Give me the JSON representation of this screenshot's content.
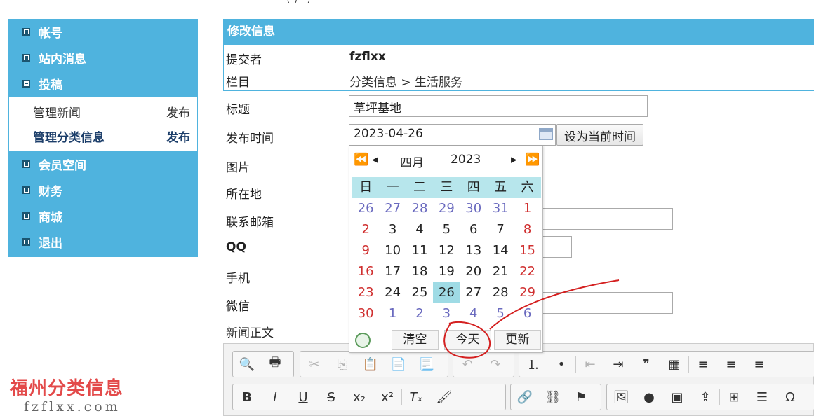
{
  "sidebar": {
    "groups": [
      {
        "label": "帐号"
      },
      {
        "label": "站内消息"
      },
      {
        "label": "投稿"
      }
    ],
    "sub_items": [
      {
        "label": "管理新闻",
        "action": "发布"
      },
      {
        "label": "管理分类信息",
        "action": "发布"
      }
    ],
    "groups2": [
      {
        "label": "会员空间"
      },
      {
        "label": "财务"
      },
      {
        "label": "商城"
      },
      {
        "label": "退出"
      }
    ]
  },
  "brand": {
    "title": "福州分类信息",
    "domain": "fzflxx.com"
  },
  "form": {
    "header": "修改信息",
    "submitter_label": "提交者",
    "submitter_value": "fzflxx",
    "category_label": "栏目",
    "category_value": "分类信息 > 生活服务",
    "title_label": "标题",
    "title_value": "草坪基地",
    "pubtime_label": "发布时间",
    "pubtime_value": "2023-04-26",
    "set_now_label": "设为当前时间",
    "image_label": "图片",
    "location_label": "所在地",
    "email_label": "联系邮箱",
    "qq_label": "QQ",
    "phone_label": "手机",
    "wechat_label": "微信",
    "body_label": "新闻正文"
  },
  "calendar": {
    "month": "四月",
    "year": "2023",
    "weekdays": [
      "日",
      "一",
      "二",
      "三",
      "四",
      "五",
      "六"
    ],
    "weeks": [
      [
        "26",
        "27",
        "28",
        "29",
        "30",
        "31",
        "1"
      ],
      [
        "2",
        "3",
        "4",
        "5",
        "6",
        "7",
        "8"
      ],
      [
        "9",
        "10",
        "11",
        "12",
        "13",
        "14",
        "15"
      ],
      [
        "16",
        "17",
        "18",
        "19",
        "20",
        "21",
        "22"
      ],
      [
        "23",
        "24",
        "25",
        "26",
        "27",
        "28",
        "29"
      ],
      [
        "30",
        "1",
        "2",
        "3",
        "4",
        "5",
        "6"
      ]
    ],
    "clear_label": "清空",
    "today_label": "今天",
    "update_label": "更新"
  },
  "colors": {
    "accent": "#4fb3de",
    "weekend": "#d03030",
    "other_month": "#6a6abf",
    "selected": "#9fdbe5",
    "annotation": "#d42020"
  }
}
